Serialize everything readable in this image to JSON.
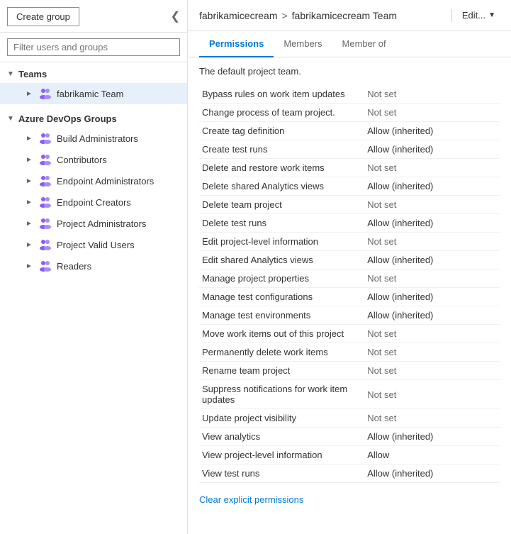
{
  "sidebar": {
    "create_group_label": "Create group",
    "filter_placeholder": "Filter users and groups",
    "collapse_icon": "❮",
    "teams_section": {
      "label": "Teams",
      "items": [
        {
          "id": "fabrikamic-team",
          "label": "fabrikamic Team",
          "active": true
        }
      ]
    },
    "azure_devops_section": {
      "label": "Azure DevOps Groups",
      "items": [
        {
          "id": "build-administrators",
          "label": "Build Administrators"
        },
        {
          "id": "contributors",
          "label": "Contributors"
        },
        {
          "id": "endpoint-administrators",
          "label": "Endpoint Administrators"
        },
        {
          "id": "endpoint-creators",
          "label": "Endpoint Creators"
        },
        {
          "id": "project-administrators",
          "label": "Project Administrators"
        },
        {
          "id": "project-valid-users",
          "label": "Project Valid Users"
        },
        {
          "id": "readers",
          "label": "Readers"
        }
      ]
    }
  },
  "main": {
    "breadcrumb": {
      "part1": "fabrikamicecream",
      "separator": ">",
      "part2": "fabrikamicecream Team"
    },
    "edit_label": "Edit...",
    "tabs": [
      {
        "id": "permissions",
        "label": "Permissions",
        "active": true
      },
      {
        "id": "members",
        "label": "Members",
        "active": false
      },
      {
        "id": "member-of",
        "label": "Member of",
        "active": false
      }
    ],
    "default_team_label": "The default project team.",
    "permissions": [
      {
        "permission": "Bypass rules on work item updates",
        "value": "Not set",
        "type": "not-set"
      },
      {
        "permission": "Change process of team project.",
        "value": "Not set",
        "type": "not-set"
      },
      {
        "permission": "Create tag definition",
        "value": "Allow (inherited)",
        "type": "allow-inherited"
      },
      {
        "permission": "Create test runs",
        "value": "Allow (inherited)",
        "type": "allow-inherited"
      },
      {
        "permission": "Delete and restore work items",
        "value": "Not set",
        "type": "not-set"
      },
      {
        "permission": "Delete shared Analytics views",
        "value": "Allow (inherited)",
        "type": "allow-inherited"
      },
      {
        "permission": "Delete team project",
        "value": "Not set",
        "type": "not-set"
      },
      {
        "permission": "Delete test runs",
        "value": "Allow (inherited)",
        "type": "allow-inherited"
      },
      {
        "permission": "Edit project-level information",
        "value": "Not set",
        "type": "not-set"
      },
      {
        "permission": "Edit shared Analytics views",
        "value": "Allow (inherited)",
        "type": "allow-inherited"
      },
      {
        "permission": "Manage project properties",
        "value": "Not set",
        "type": "not-set"
      },
      {
        "permission": "Manage test configurations",
        "value": "Allow (inherited)",
        "type": "allow-inherited"
      },
      {
        "permission": "Manage test environments",
        "value": "Allow (inherited)",
        "type": "allow-inherited"
      },
      {
        "permission": "Move work items out of this project",
        "value": "Not set",
        "type": "not-set"
      },
      {
        "permission": "Permanently delete work items",
        "value": "Not set",
        "type": "not-set"
      },
      {
        "permission": "Rename team project",
        "value": "Not set",
        "type": "not-set"
      },
      {
        "permission": "Suppress notifications for work item updates",
        "value": "Not set",
        "type": "not-set"
      },
      {
        "permission": "Update project visibility",
        "value": "Not set",
        "type": "not-set"
      },
      {
        "permission": "View analytics",
        "value": "Allow (inherited)",
        "type": "allow-inherited"
      },
      {
        "permission": "View project-level information",
        "value": "Allow",
        "type": "allow"
      },
      {
        "permission": "View test runs",
        "value": "Allow (inherited)",
        "type": "allow-inherited"
      }
    ],
    "clear_permissions_label": "Clear explicit permissions"
  }
}
